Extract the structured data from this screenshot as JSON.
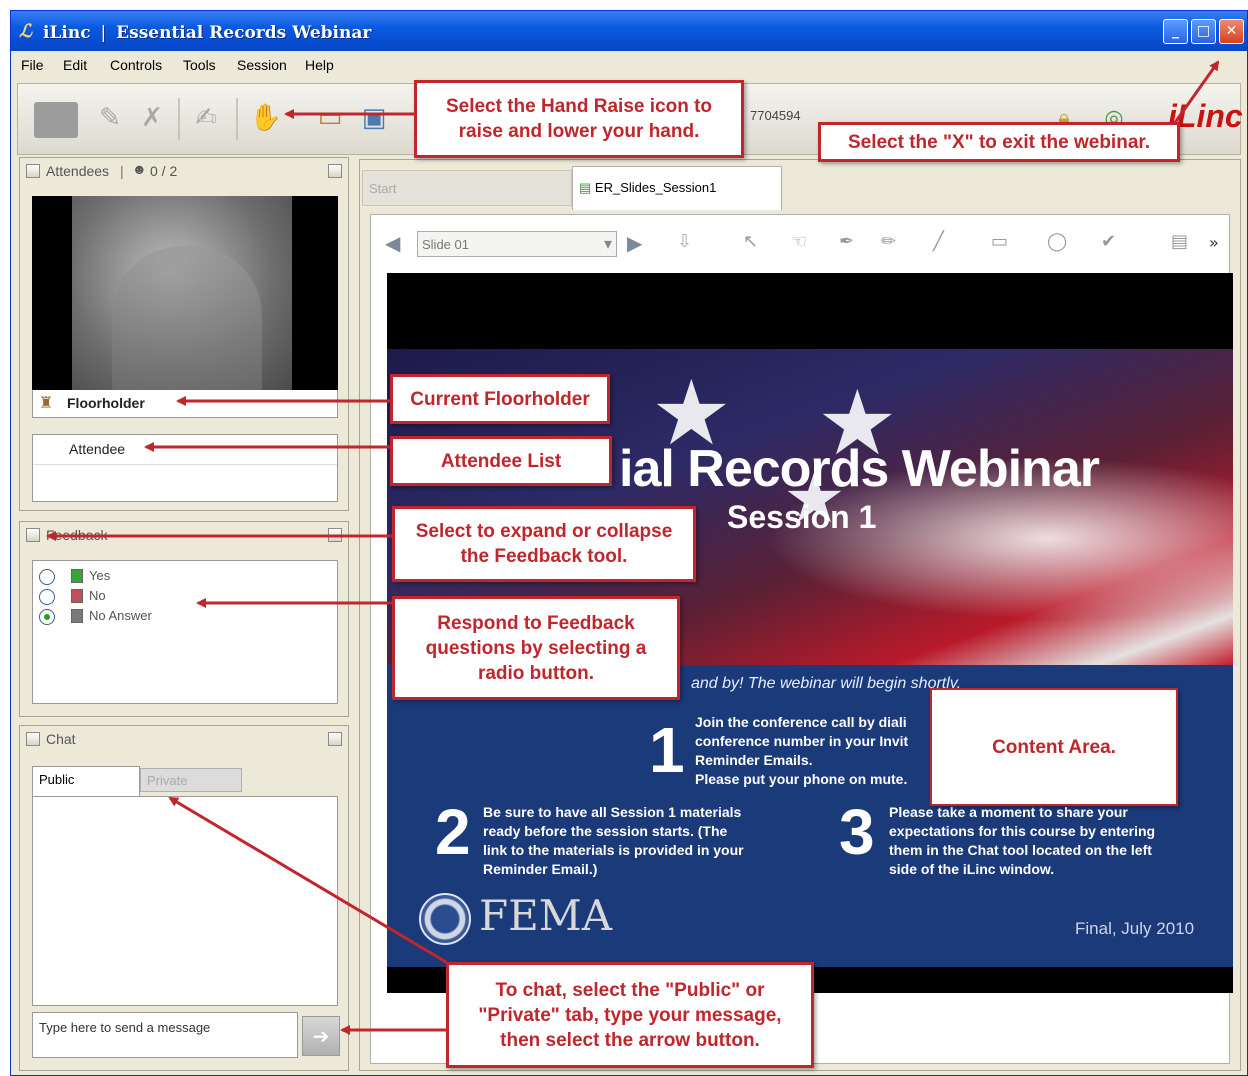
{
  "window": {
    "app_name": "iLinc",
    "separator": "|",
    "title": "Essential Records Webinar",
    "logo_glyph": "ℒ",
    "controls": {
      "minimize": "_",
      "maximize": "□",
      "close": "✕"
    }
  },
  "menu": [
    "File",
    "Edit",
    "Controls",
    "Tools",
    "Session",
    "Help"
  ],
  "toolbar": {
    "session_id": "7704594",
    "brand": "iLinc",
    "icons": [
      "webcam-icon",
      "pencil-disabled-icon",
      "mic-disabled-icon",
      "pencil-off-icon",
      "hand-raise-icon",
      "podium-icon",
      "screen-share-icon",
      "lock-icon",
      "globe-icon"
    ]
  },
  "attendees_panel": {
    "title": "Attendees",
    "count": "0 / 2",
    "floorholder_label": "Floorholder",
    "list": [
      "Attendee"
    ]
  },
  "feedback_panel": {
    "title": "Feedback",
    "options": [
      {
        "label": "Yes",
        "color": "#3aa33a",
        "selected": false
      },
      {
        "label": "No",
        "color": "#c0505a",
        "selected": false
      },
      {
        "label": "No Answer",
        "color": "#7a7a7a",
        "selected": true
      }
    ]
  },
  "chat_panel": {
    "title": "Chat",
    "tabs": [
      "Public",
      "Private"
    ],
    "input_placeholder": "Type here to send a message",
    "send_icon": "➔"
  },
  "content": {
    "tabs": [
      "Start",
      "ER_Slides_Session1"
    ],
    "slide_selector": "Slide 01",
    "more": "»",
    "slide": {
      "title": "ial Records Webinar",
      "subtitle": "Session 1",
      "stand_by": "and by!  The webinar will begin shortly.",
      "step1_num": "1",
      "step1_text": "Join the conference call by diali\nconference number in your Invit\nReminder Emails.\nPlease put your phone on mute.",
      "step2_num": "2",
      "step2_text": "Be sure to have all Session 1 materials\nready before the session starts. (The\nlink to the materials is provided in your\nReminder Email.)",
      "step3_num": "3",
      "step3_text": "Please take a moment to share your\nexpectations for this course by entering\nthem in the Chat tool located on the left\nside of the iLinc window.",
      "agency": "FEMA",
      "date": "Final, July 2010"
    }
  },
  "callouts": {
    "hand_raise": "Select the Hand Raise icon to\nraise and lower your hand.",
    "exit": "Select the \"X\" to exit the webinar.",
    "floorholder": "Current Floorholder",
    "attendee_list": "Attendee List",
    "feedback_toggle": "Select to expand or collapse\nthe Feedback tool.",
    "feedback_respond": "Respond to Feedback\nquestions by selecting a\nradio button.",
    "content_area": "Content Area.",
    "chat": "To chat, select the \"Public\" or\n\"Private\" tab, type your message,\nthen select the arrow button."
  },
  "colors": {
    "callout_red": "#c0262c",
    "titlebar_blue": "#0a5ae0",
    "window_bg": "#ece9d8"
  }
}
